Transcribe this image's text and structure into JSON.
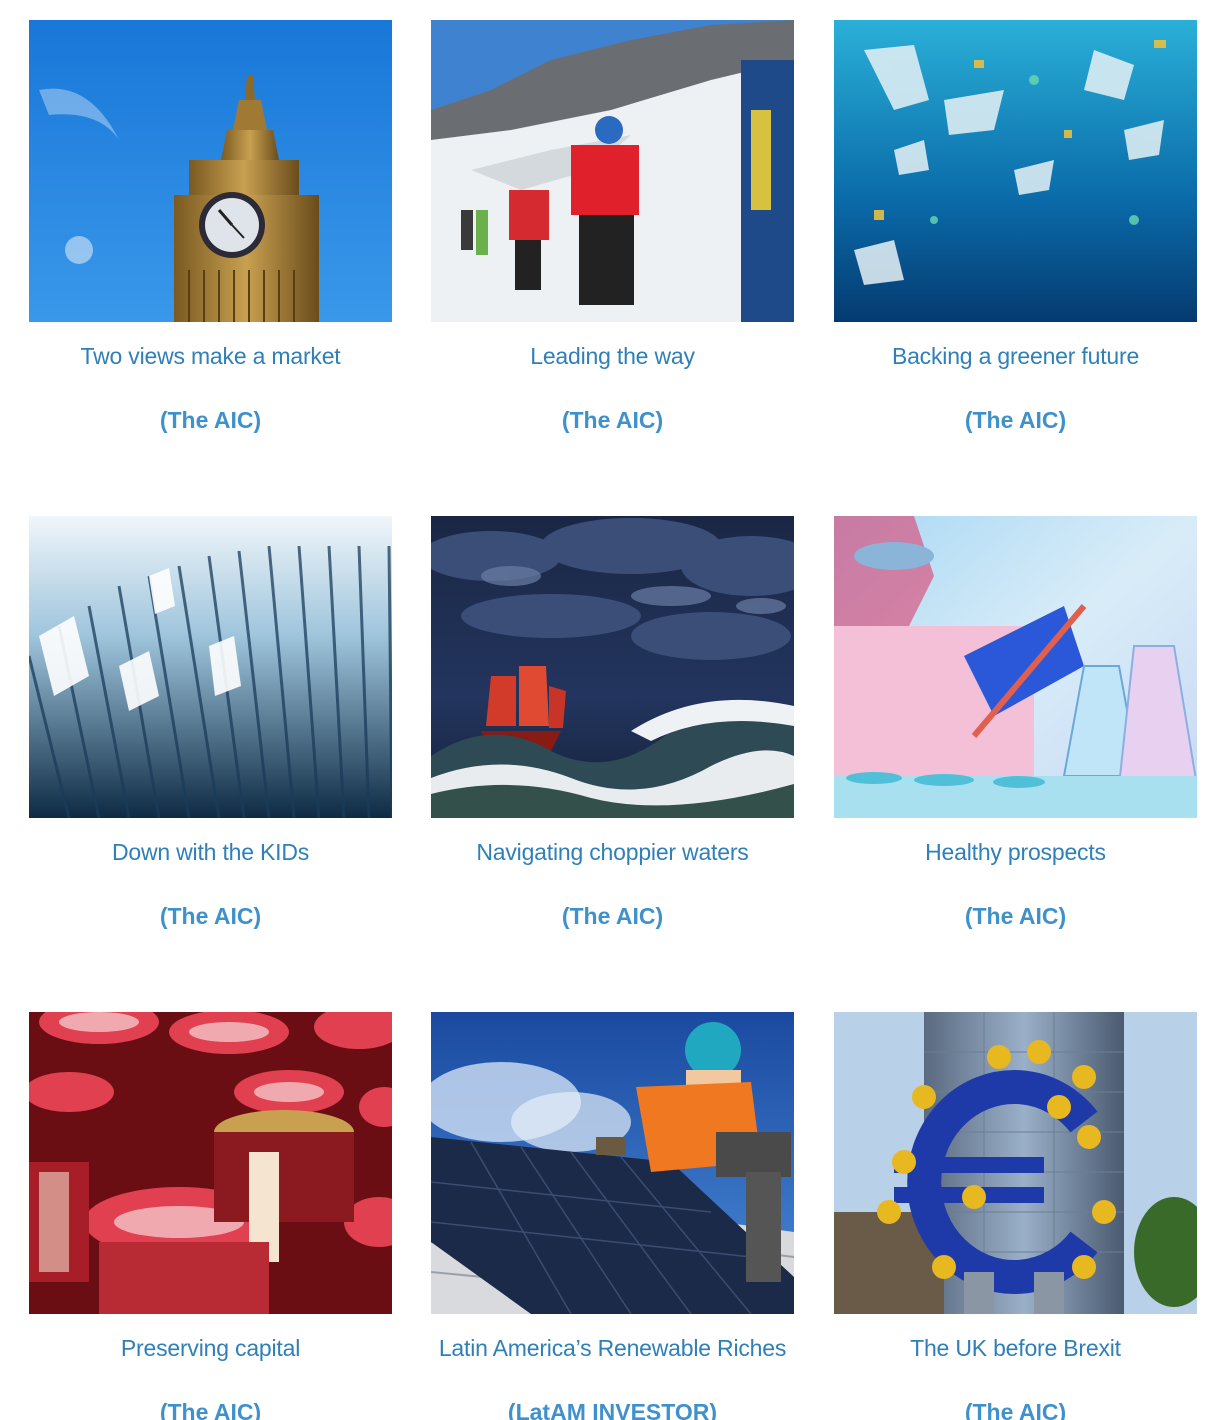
{
  "articles": [
    {
      "title": "Two views make a market",
      "source": "(The AIC)",
      "image": "big-ben-clock-tower"
    },
    {
      "title": "Leading the way",
      "source": "(The AIC)",
      "image": "mountain-climbers-snow"
    },
    {
      "title": "Backing a greener future",
      "source": "(The AIC)",
      "image": "ocean-plastic-pollution"
    },
    {
      "title": "Down with the KIDs",
      "source": "(The AIC)",
      "image": "filing-folders"
    },
    {
      "title": "Navigating choppier waters",
      "source": "(The AIC)",
      "image": "ship-stormy-sea"
    },
    {
      "title": "Healthy prospects",
      "source": "(The AIC)",
      "image": "lab-scientist-pipette"
    },
    {
      "title": "Preserving capital",
      "source": "(The AIC)",
      "image": "jam-jars"
    },
    {
      "title": "Latin America’s Renewable Riches",
      "source": "(LatAM INVESTOR)",
      "image": "solar-panel-worker"
    },
    {
      "title": "The UK before Brexit",
      "source": "(The AIC)",
      "image": "euro-sculpture"
    }
  ],
  "colors": {
    "title": "#2f7fb8",
    "source": "#3e91cc",
    "background": "#ffffff"
  }
}
